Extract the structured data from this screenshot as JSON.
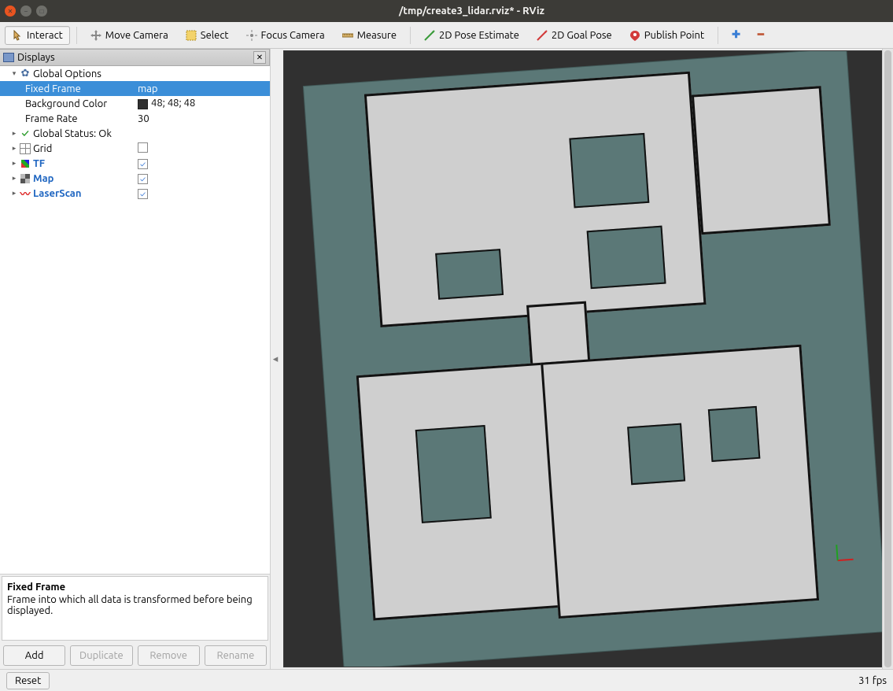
{
  "window": {
    "title": "/tmp/create3_lidar.rviz* - RViz"
  },
  "toolbar": {
    "interact": "Interact",
    "move_camera": "Move Camera",
    "select": "Select",
    "focus_camera": "Focus Camera",
    "measure": "Measure",
    "pose_estimate": "2D Pose Estimate",
    "goal_pose": "2D Goal Pose",
    "publish_point": "Publish Point"
  },
  "panel": {
    "title": "Displays",
    "tree": {
      "global_options": {
        "label": "Global Options",
        "fixed_frame": {
          "label": "Fixed Frame",
          "value": "map"
        },
        "background_color": {
          "label": "Background Color",
          "value": "48; 48; 48"
        },
        "frame_rate": {
          "label": "Frame Rate",
          "value": "30"
        }
      },
      "global_status": {
        "label": "Global Status: Ok"
      },
      "grid": {
        "label": "Grid",
        "checked": false
      },
      "tf": {
        "label": "TF",
        "checked": true
      },
      "map": {
        "label": "Map",
        "checked": true
      },
      "laserscan": {
        "label": "LaserScan",
        "checked": true
      }
    },
    "description": {
      "heading": "Fixed Frame",
      "body": "Frame into which all data is transformed before being displayed."
    },
    "buttons": {
      "add": "Add",
      "duplicate": "Duplicate",
      "remove": "Remove",
      "rename": "Rename"
    }
  },
  "status": {
    "reset": "Reset",
    "fps": "31 fps"
  }
}
